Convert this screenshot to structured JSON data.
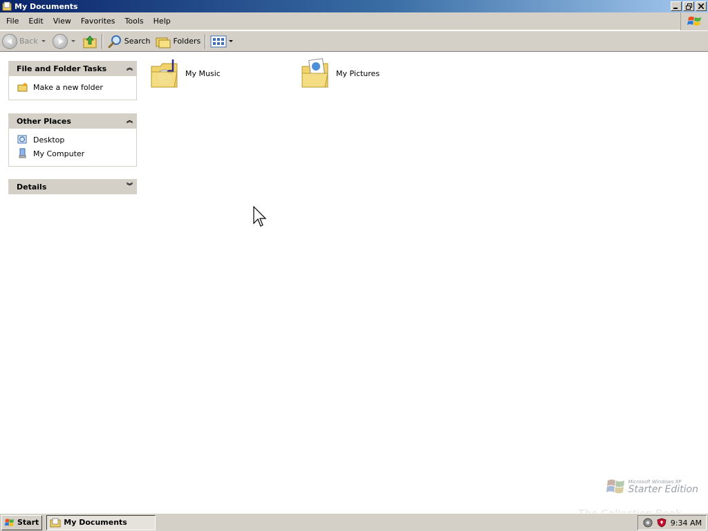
{
  "window": {
    "title": "My Documents",
    "controls": [
      "minimize",
      "maximize",
      "close"
    ]
  },
  "menu": {
    "items": [
      "File",
      "Edit",
      "View",
      "Favorites",
      "Tools",
      "Help"
    ]
  },
  "toolbar": {
    "back_label": "Back",
    "search_label": "Search",
    "folders_label": "Folders"
  },
  "task_pane": {
    "file_tasks": {
      "title": "File and Folder Tasks",
      "items": [
        "Make a new folder"
      ]
    },
    "other_places": {
      "title": "Other Places",
      "items": [
        "Desktop",
        "My Computer"
      ]
    },
    "details": {
      "title": "Details"
    }
  },
  "content": {
    "folders": [
      {
        "name": "My Music",
        "icon": "music-folder-icon"
      },
      {
        "name": "My Pictures",
        "icon": "pictures-folder-icon"
      }
    ]
  },
  "watermark": {
    "small": "Microsoft Windows XP",
    "big": "Starter Edition"
  },
  "taskbar": {
    "start_label": "Start",
    "task_label": "My Documents",
    "clock": "9:34 AM"
  },
  "overlay": {
    "brand": "The Collection Book"
  },
  "colors": {
    "title_gradient_start": "#0a246a",
    "title_gradient_end": "#a6caf0",
    "chrome": "#d4d0c8"
  }
}
